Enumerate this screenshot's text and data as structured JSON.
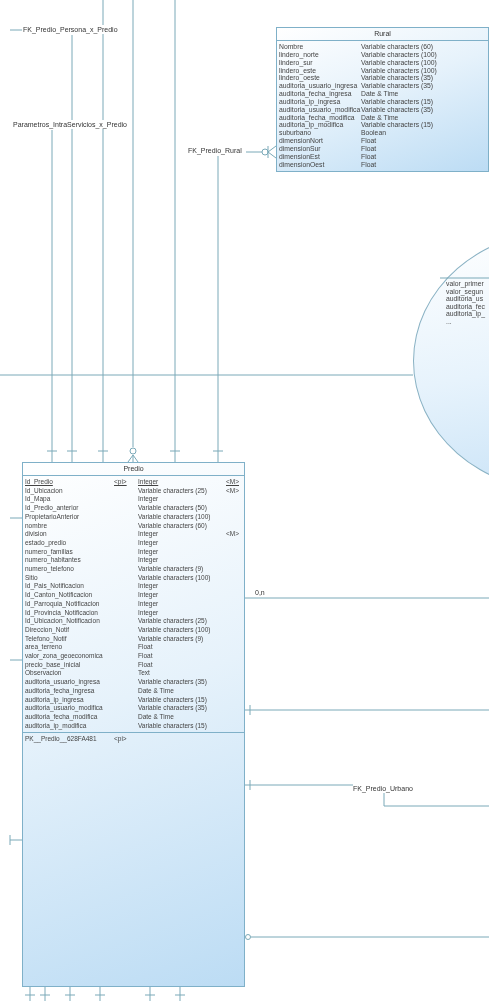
{
  "relationship_labels": [
    {
      "text": "FK_Predio_Persona_x_Predio"
    },
    {
      "text": "Parametros_IntraServicios_x_Predio"
    },
    {
      "text": "FK_Predio_Rural"
    },
    {
      "text": "0,n"
    },
    {
      "text": "FK_Predio_Urbano"
    }
  ],
  "rural": {
    "title": "Rural",
    "columns": [
      {
        "name": "Nombre",
        "type": "Variable characters (60)"
      },
      {
        "name": "lindero_norte",
        "type": "Variable characters (100)"
      },
      {
        "name": "lindero_sur",
        "type": "Variable characters (100)"
      },
      {
        "name": "lindero_este",
        "type": "Variable characters (100)"
      },
      {
        "name": "lindero_oeste",
        "type": "Variable characters (35)"
      },
      {
        "name": "auditoria_usuario_ingresa",
        "type": "Variable characters (35)"
      },
      {
        "name": "auditoria_fecha_ingresa",
        "type": "Date & Time"
      },
      {
        "name": "auditoria_ip_ingresa",
        "type": "Variable characters (15)"
      },
      {
        "name": "auditoria_usuario_modifica",
        "type": "Variable characters (35)"
      },
      {
        "name": "auditoria_fecha_modifica",
        "type": "Date & Time"
      },
      {
        "name": "auditoria_ip_modifica",
        "type": "Variable characters (15)"
      },
      {
        "name": "suburbano",
        "type": "Boolean"
      },
      {
        "name": "dimensionNort",
        "type": "Float"
      },
      {
        "name": "dimensionSur",
        "type": "Float"
      },
      {
        "name": "dimensionEst",
        "type": "Float"
      },
      {
        "name": "dimensionOest",
        "type": "Float"
      }
    ]
  },
  "ellipse_entity": {
    "attributes": [
      "valor_primer",
      "valor_segun",
      "auditoria_us",
      "auditoria_fec",
      "auditoria_ip_",
      "..."
    ]
  },
  "predio": {
    "title": "Predio",
    "columns": [
      {
        "name": "Id_Predio",
        "key": "<pi>",
        "type": "Integer",
        "mandatory": "<M>",
        "identifier": true
      },
      {
        "name": "Id_Ubicacion",
        "type": "Variable characters (25)",
        "mandatory": "<M>",
        "identifier": false
      },
      {
        "name": "Id_Mapa",
        "type": "Integer",
        "identifier": false
      },
      {
        "name": "Id_Predio_anterior",
        "type": "Variable characters (50)",
        "identifier": false
      },
      {
        "name": "PropietarioAnterior",
        "type": "Variable characters (100)",
        "identifier": false
      },
      {
        "name": "nombre",
        "type": "Variable characters (60)",
        "identifier": false
      },
      {
        "name": "division",
        "type": "Integer",
        "mandatory": "<M>",
        "identifier": false
      },
      {
        "name": "estado_predio",
        "type": "Integer",
        "identifier": false
      },
      {
        "name": "numero_familias",
        "type": "Integer",
        "identifier": false
      },
      {
        "name": "numero_habitantes",
        "type": "Integer",
        "identifier": false
      },
      {
        "name": "numero_telefono",
        "type": "Variable characters (9)",
        "identifier": false
      },
      {
        "name": "Sitio",
        "type": "Variable characters (100)",
        "identifier": false
      },
      {
        "name": "Id_Pais_Notificacion",
        "type": "Integer",
        "identifier": false
      },
      {
        "name": "Id_Canton_Notificacion",
        "type": "Integer",
        "identifier": false
      },
      {
        "name": "Id_Parroquia_Notificacion",
        "type": "Integer",
        "identifier": false
      },
      {
        "name": "Id_Provincia_Notificacion",
        "type": "Integer",
        "identifier": false
      },
      {
        "name": "Id_Ubicacion_Notificacion",
        "type": "Variable characters (25)",
        "identifier": false
      },
      {
        "name": "Direccion_Notif",
        "type": "Variable characters (100)",
        "identifier": false
      },
      {
        "name": "Telefono_Notif",
        "type": "Variable characters (9)",
        "identifier": false
      },
      {
        "name": "area_terreno",
        "type": "Float",
        "identifier": false
      },
      {
        "name": "valor_zona_geoeconomica",
        "type": "Float",
        "identifier": false
      },
      {
        "name": "precio_base_inicial",
        "type": "Float",
        "identifier": false
      },
      {
        "name": "Observacion",
        "type": "Text",
        "identifier": false
      },
      {
        "name": "auditoria_usuario_ingresa",
        "type": "Variable characters (35)",
        "identifier": false
      },
      {
        "name": "auditoria_fecha_ingresa",
        "type": "Date & Time",
        "identifier": false
      },
      {
        "name": "auditoria_ip_ingresa",
        "type": "Variable characters (15)",
        "identifier": false
      },
      {
        "name": "auditoria_usuario_modifica",
        "type": "Variable characters (35)",
        "identifier": false
      },
      {
        "name": "auditoria_fecha_modifica",
        "type": "Date & Time",
        "identifier": false
      },
      {
        "name": "auditoria_ip_modifica",
        "type": "Variable characters (15)",
        "identifier": false
      }
    ],
    "keys": [
      {
        "name": "PK__Predio__628FA481",
        "key": "<pi>"
      }
    ]
  }
}
